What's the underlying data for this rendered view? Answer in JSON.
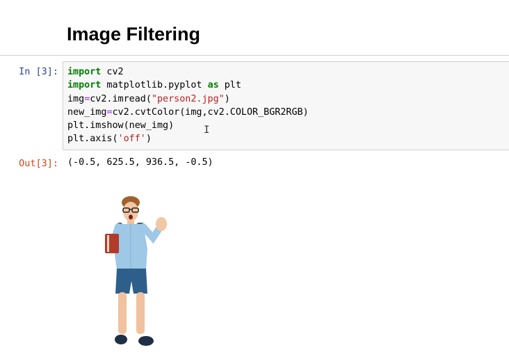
{
  "notebook": {
    "heading": "Image Filtering",
    "cell": {
      "in_prompt": "In [3]:",
      "out_prompt": "Out[3]:",
      "code": {
        "line1": {
          "kw1": "import",
          "rest": " cv2"
        },
        "line2": {
          "kw1": "import",
          "mid": " matplotlib.pyplot ",
          "kw2": "as",
          "rest": " plt"
        },
        "line3": {
          "a": "img",
          "op": "=",
          "b": "cv2.imread(",
          "str": "\"person2.jpg\"",
          "c": ")"
        },
        "line4": {
          "a": "new_img",
          "op": "=",
          "b": "cv2.cvtColor(img,cv2.COLOR_BGR2RGB)"
        },
        "line5": {
          "a": "plt.imshow(new_img)"
        },
        "line6": {
          "a": "plt.axis(",
          "str": "'off'",
          "c": ")"
        }
      },
      "output_text": "(-0.5, 625.5, 936.5, -0.5)",
      "output_image_icon": "person-image"
    }
  }
}
